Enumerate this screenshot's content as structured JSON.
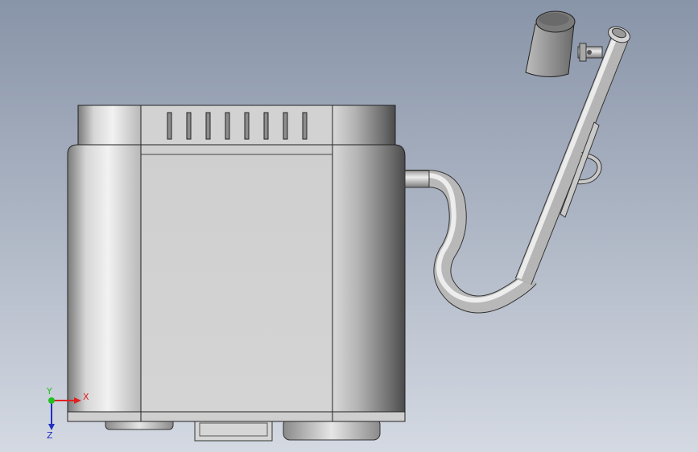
{
  "viewport": {
    "background_top": "#8894a8",
    "background_bottom": "#d4d9e2"
  },
  "model": {
    "parts": [
      "tank-body",
      "tank-top-rim",
      "vent-slots",
      "bottom-feet",
      "bottom-bracket",
      "outlet-pipe",
      "pipe-bend",
      "riser-pipe",
      "mounting-bracket",
      "pipe-cap",
      "lamp-head"
    ],
    "vent_slot_count": 8
  },
  "triad": {
    "x_label": "X",
    "y_label": "Y",
    "z_label": "Z",
    "x_color": "#e02020",
    "y_color": "#20c020",
    "z_color": "#2030c0"
  }
}
